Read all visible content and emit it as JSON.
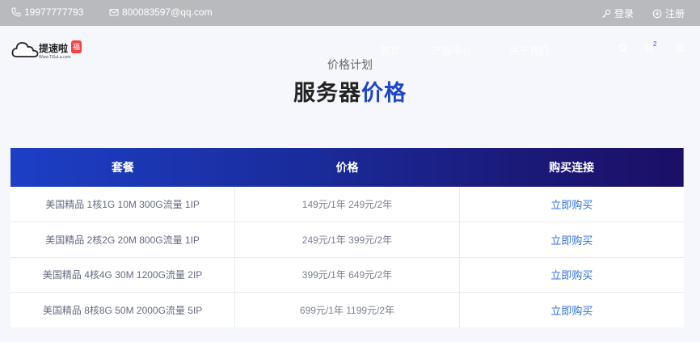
{
  "topbar": {
    "phone": "19977777793",
    "email": "800083597@qq.com",
    "login": "登录",
    "register": "注册"
  },
  "header": {
    "brand": "提速啦",
    "brand_url": "Www.TiSuLa.com",
    "brand_badge": "福",
    "nav": [
      "首页",
      "产品中心",
      "关于我们"
    ],
    "cart_count": "2"
  },
  "section": {
    "subtitle": "价格计划",
    "title_main": "服务器",
    "title_accent": "价格"
  },
  "table": {
    "headers": [
      "套餐",
      "价格",
      "购买连接"
    ],
    "rows": [
      {
        "plan": "美国精品 1核1G 10M 300G流量 1IP",
        "price": "149元/1年 249元/2年",
        "buy": "立即购买"
      },
      {
        "plan": "美国精品 2核2G 20M 800G流量 1IP",
        "price": "249元/1年 399元/2年",
        "buy": "立即购买"
      },
      {
        "plan": "美国精品 4核4G 30M 1200G流量 2IP",
        "price": "399元/1年 649元/2年",
        "buy": "立即购买"
      },
      {
        "plan": "美国精品 8核8G 50M 2000G流量 5IP",
        "price": "699元/1年 1199元/2年",
        "buy": "立即购买"
      }
    ]
  },
  "colors": {
    "accent": "#1f45c8",
    "link": "#2f6fe0",
    "topbar": "#b9babe"
  },
  "icons": [
    "phone-icon",
    "mail-icon",
    "key-icon",
    "register-icon",
    "search-icon",
    "cart-icon",
    "menu-icon",
    "cloud-logo-icon"
  ]
}
